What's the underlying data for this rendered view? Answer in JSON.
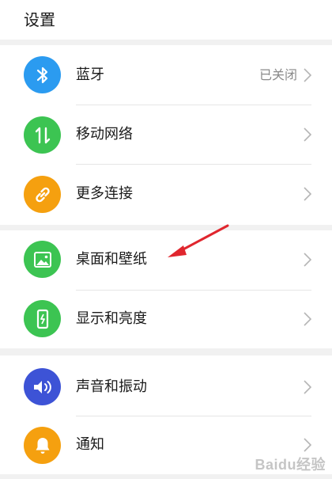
{
  "header": {
    "title": "设置"
  },
  "groups": [
    {
      "items": [
        {
          "label": "蓝牙",
          "value": "已关闭",
          "icon": "bluetooth-icon",
          "color": "#2b9bf0"
        },
        {
          "label": "移动网络",
          "icon": "mobile-data-icon",
          "color": "#3cc452"
        },
        {
          "label": "更多连接",
          "icon": "link-icon",
          "color": "#f5a00f"
        }
      ]
    },
    {
      "items": [
        {
          "label": "桌面和壁纸",
          "icon": "wallpaper-icon",
          "color": "#3cc452"
        },
        {
          "label": "显示和亮度",
          "icon": "display-brightness-icon",
          "color": "#3cc452"
        }
      ]
    },
    {
      "items": [
        {
          "label": "声音和振动",
          "icon": "sound-icon",
          "color": "#3d53d6"
        },
        {
          "label": "通知",
          "icon": "notification-bell-icon",
          "color": "#f5a00f"
        }
      ]
    }
  ],
  "annotation": {
    "color": "#e0262e"
  },
  "watermark": {
    "text": "Baidu经验"
  }
}
